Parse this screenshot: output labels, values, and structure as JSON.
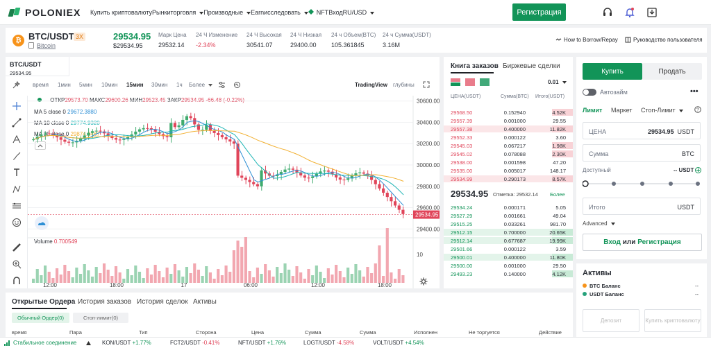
{
  "header": {
    "brand": "POLONIEX",
    "nav": [
      "Купить криптовалюту",
      "Рынки",
      "торговля",
      "Производные",
      "Earn",
      "исследовать",
      "NFT"
    ],
    "register": "Регистрация",
    "login": "Вход",
    "lang": "RU/USD"
  },
  "ticker": {
    "pair": "BTC/USDT",
    "leverage": "3X",
    "coin_link": "Bitcoin",
    "last_price": "29534.95",
    "last_price_usd": "$29534.95",
    "stats": [
      {
        "label": "Марк Цена",
        "value": "29532.14"
      },
      {
        "label": "24 Ч Изменение",
        "value": "-2.34%"
      },
      {
        "label": "24 Ч Высокая",
        "value": "30541.07"
      },
      {
        "label": "24 Ч Низкая",
        "value": "29400.00"
      },
      {
        "label": "24 ч Объем(BTC)",
        "value": "105.361845"
      },
      {
        "label": "24 ч Сумма(USDT)",
        "value": "3.16M"
      }
    ],
    "borrow": "How to Borrow/Repay",
    "guide": "Руководство пользователя"
  },
  "chart": {
    "symbol": "BTC/USDT",
    "symbol_price": "29534.95",
    "timeframes": [
      "время",
      "1мин",
      "5мин",
      "10мин",
      "15мин",
      "30мин",
      "1ч",
      "Более"
    ],
    "active_tf": "15мин",
    "tradingview": "TradingView",
    "depth": "глубины",
    "ohlc": {
      "open_label": "ОТКР",
      "open": "29573.70",
      "high_label": "МАКС",
      "high": "29600.26",
      "low_label": "МИН",
      "low": "29523.45",
      "close_label": "ЗАКР",
      "close": "29534.95",
      "change": "-66.48 (-0.22%)"
    },
    "ma": [
      {
        "label": "MA 5 close 0",
        "value": "29672.3880",
        "color": "#2d8fd5"
      },
      {
        "label": "MA 10 close 0",
        "value": "29774.9320",
        "color": "#1fb5b5"
      },
      {
        "label": "MA 30 close 0",
        "value": "29874.0467",
        "color": "#f2b134"
      }
    ],
    "volume_label": "Volume",
    "volume_value": "0.700549",
    "vol_tick": "10",
    "y_ticks": [
      "30600.00",
      "30400.00",
      "30200.00",
      "30000.00",
      "29800.00",
      "29600.00",
      "29400.00"
    ],
    "x_ticks": [
      "12:00",
      "18:00",
      "17",
      "06:00",
      "12:00",
      "18:00"
    ],
    "price_tag": "29534.95"
  },
  "book": {
    "tab1": "Книга заказов",
    "tab2": "Биржевые сделки",
    "precision": "0.01",
    "cols": [
      "ЦЕНА(USDT)",
      "Сумма(BTC)",
      "Итого(USDT)"
    ],
    "asks": [
      [
        "29568.50",
        "0.152940",
        "4.52K"
      ],
      [
        "29557.39",
        "0.001000",
        "29.55"
      ],
      [
        "29557.38",
        "0.400000",
        "11.82K"
      ],
      [
        "29552.33",
        "0.000122",
        "3.60"
      ],
      [
        "29545.03",
        "0.067217",
        "1.98K"
      ],
      [
        "29545.02",
        "0.078088",
        "2.30K"
      ],
      [
        "29538.00",
        "0.001598",
        "47.20"
      ],
      [
        "29535.00",
        "0.005017",
        "148.17"
      ],
      [
        "29534.99",
        "0.290173",
        "8.57K"
      ]
    ],
    "mid": "29534.95",
    "mark_label": "Отметка:",
    "mark": "29532.14",
    "more": "Более",
    "bids": [
      [
        "29534.24",
        "0.000171",
        "5.05"
      ],
      [
        "29527.29",
        "0.001661",
        "49.04"
      ],
      [
        "29515.25",
        "0.033261",
        "981.70"
      ],
      [
        "29512.15",
        "0.700000",
        "20.65K"
      ],
      [
        "29512.14",
        "0.677687",
        "19.99K"
      ],
      [
        "29501.66",
        "0.000122",
        "3.59"
      ],
      [
        "29500.01",
        "0.400000",
        "11.80K"
      ],
      [
        "29500.00",
        "0.001000",
        "29.50"
      ],
      [
        "29493.23",
        "0.140000",
        "4.12K"
      ]
    ]
  },
  "trade": {
    "buy": "Купить",
    "sell": "Продать",
    "autoloan": "Автозайм",
    "types": [
      "Лимит",
      "Маркет",
      "Стоп-Лимит"
    ],
    "price_label": "ЦЕНА",
    "price_value": "29534.95",
    "price_unit": "USDT",
    "amount_label": "Сумма",
    "amount_unit": "BTC",
    "avail_label": "Доступный",
    "avail_value": "-- USDT",
    "total_label": "Итого",
    "total_unit": "USDT",
    "advanced": "Advanced",
    "login_btn": "Вход",
    "or": "или",
    "reg_btn": "Регистрация"
  },
  "assets": {
    "title": "Активы",
    "btc": "BTC Баланс",
    "usdt": "USDT Баланс",
    "dash": "--",
    "deposit": "Депозит",
    "buy_crypto": "Купить криптовалюту"
  },
  "orders": {
    "tabs": [
      "Открытые Ордера",
      "История заказов",
      "История сделок",
      "Активы"
    ],
    "sub": [
      "Обычный Ордер(0)",
      "Стоп-лимит(0)"
    ],
    "cols": [
      "время",
      "Пара",
      "Тип",
      "Сторона",
      "Цена",
      "Сумма",
      "Сумма",
      "Исполнен",
      "Не торгуется",
      "Действие"
    ]
  },
  "footer": {
    "status": "Стабильное соединение",
    "items": [
      {
        "pair": "KON/USDT",
        "chg": "+1.77%",
        "up": true
      },
      {
        "pair": "FCT2/USDT",
        "chg": "-0.41%",
        "up": false
      },
      {
        "pair": "NFT/USDT",
        "chg": "+1.76%",
        "up": true
      },
      {
        "pair": "LOGT/USDT",
        "chg": "-4.58%",
        "up": false
      },
      {
        "pair": "VOLT/USDT",
        "chg": "+4.54%",
        "up": true
      }
    ]
  },
  "colors": {
    "green": "#129458",
    "red": "#e0455a",
    "ask_bg": "#fbe6e8",
    "bid_bg": "#e3f4ea"
  }
}
